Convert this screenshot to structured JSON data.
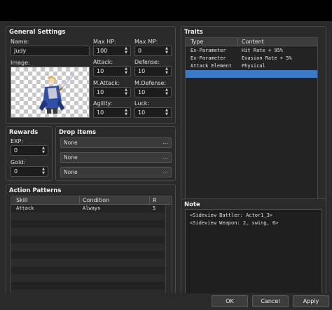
{
  "general": {
    "title": "General Settings",
    "name_label": "Name:",
    "name_value": "Judy",
    "image_label": "Image:",
    "max_hp_label": "Max HP:",
    "max_hp": "100",
    "max_mp_label": "Max MP:",
    "max_mp": "0",
    "attack_label": "Attack:",
    "attack": "10",
    "defense_label": "Defense:",
    "defense": "10",
    "mattack_label": "M.Attack:",
    "mattack": "10",
    "mdefense_label": "M.Defense:",
    "mdefense": "10",
    "agility_label": "Agility:",
    "agility": "10",
    "luck_label": "Luck:",
    "luck": "10"
  },
  "rewards": {
    "title": "Rewards",
    "exp_label": "EXP:",
    "exp": "0",
    "gold_label": "Gold:",
    "gold": "0"
  },
  "drop_items": {
    "title": "Drop Items",
    "items": [
      "None",
      "None",
      "None"
    ],
    "more": "…"
  },
  "action_patterns": {
    "title": "Action Patterns",
    "columns": [
      "Skill",
      "Condition",
      "R"
    ],
    "rows": [
      {
        "skill": "Attack",
        "condition": "Always",
        "r": "5"
      }
    ]
  },
  "traits": {
    "title": "Traits",
    "columns": [
      "Type",
      "Content"
    ],
    "rows": [
      {
        "type": "Ex-Parameter",
        "content": "Hit Rate + 95%"
      },
      {
        "type": "Ex-Parameter",
        "content": "Evasion Rate + 5%"
      },
      {
        "type": "Attack Element",
        "content": "Physical"
      }
    ]
  },
  "note": {
    "title": "Note",
    "lines": [
      "<Sideview Battler: Actor1_3>",
      "<Sideview Weapon: 2, swing, 6>"
    ]
  },
  "buttons": {
    "ok": "OK",
    "cancel": "Cancel",
    "apply": "Apply"
  },
  "icons": {
    "spin": "spin-arrows-icon",
    "more": "ellipsis-icon"
  },
  "colors": {
    "selection": "#3d79c9",
    "panel": "#2a2a2a"
  }
}
